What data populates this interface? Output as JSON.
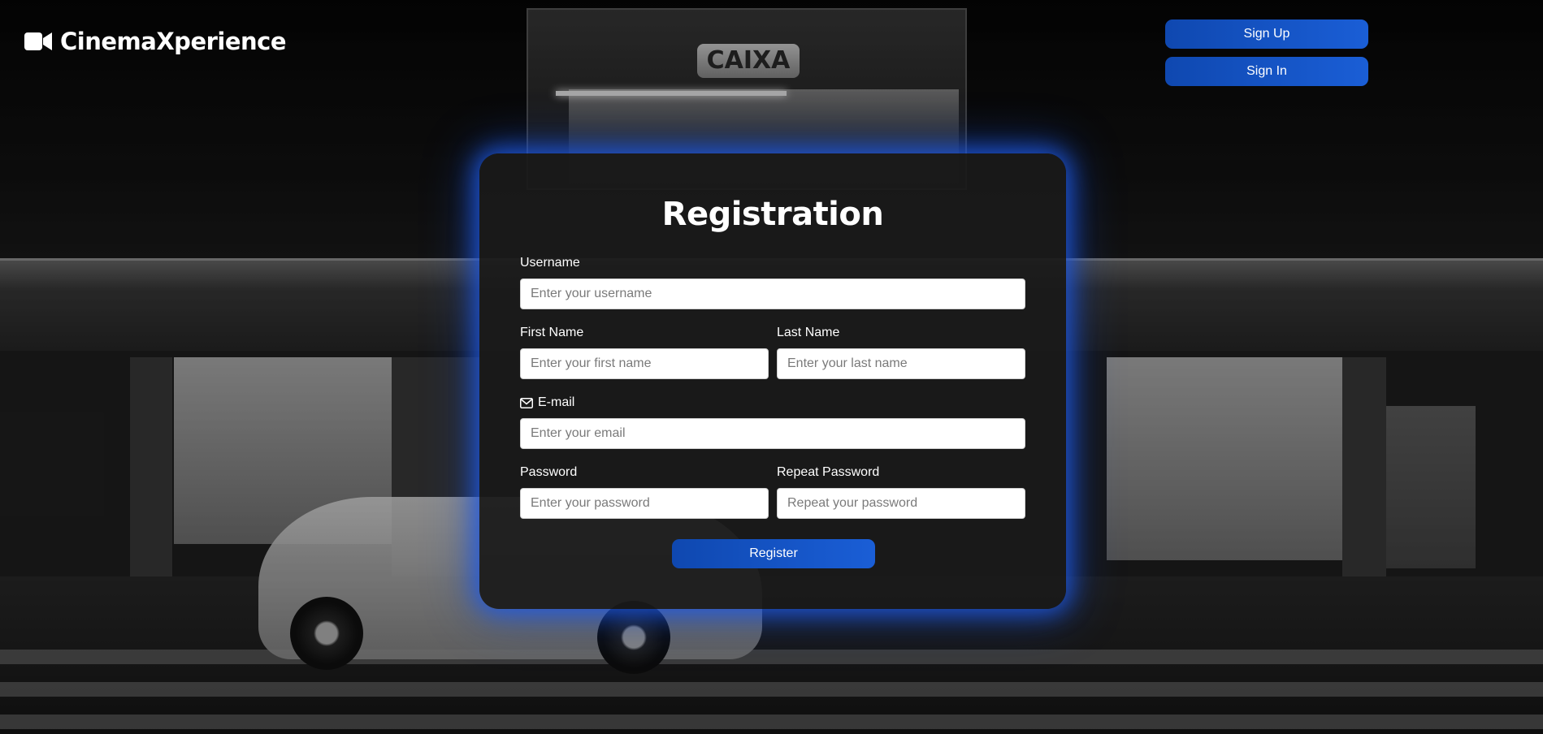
{
  "header": {
    "brand_name": "CinemaXperience",
    "brand_icon": "video-camera-icon",
    "signup_label": "Sign Up",
    "signin_label": "Sign In"
  },
  "form": {
    "title": "Registration",
    "username": {
      "label": "Username",
      "placeholder": "Enter your username",
      "value": ""
    },
    "first_name": {
      "label": "First Name",
      "placeholder": "Enter your first name",
      "value": ""
    },
    "last_name": {
      "label": "Last Name",
      "placeholder": "Enter your last name",
      "value": ""
    },
    "email": {
      "label": "E-mail",
      "icon": "envelope-icon",
      "placeholder": "Enter your email",
      "value": ""
    },
    "password": {
      "label": "Password",
      "placeholder": "Enter your password",
      "value": ""
    },
    "repeat_password": {
      "label": "Repeat Password",
      "placeholder": "Repeat your password",
      "value": ""
    },
    "submit_label": "Register"
  },
  "colors": {
    "accent": "#1a5ed6",
    "glow": "#1e5ae6",
    "card_background": "#1a1a1a"
  }
}
